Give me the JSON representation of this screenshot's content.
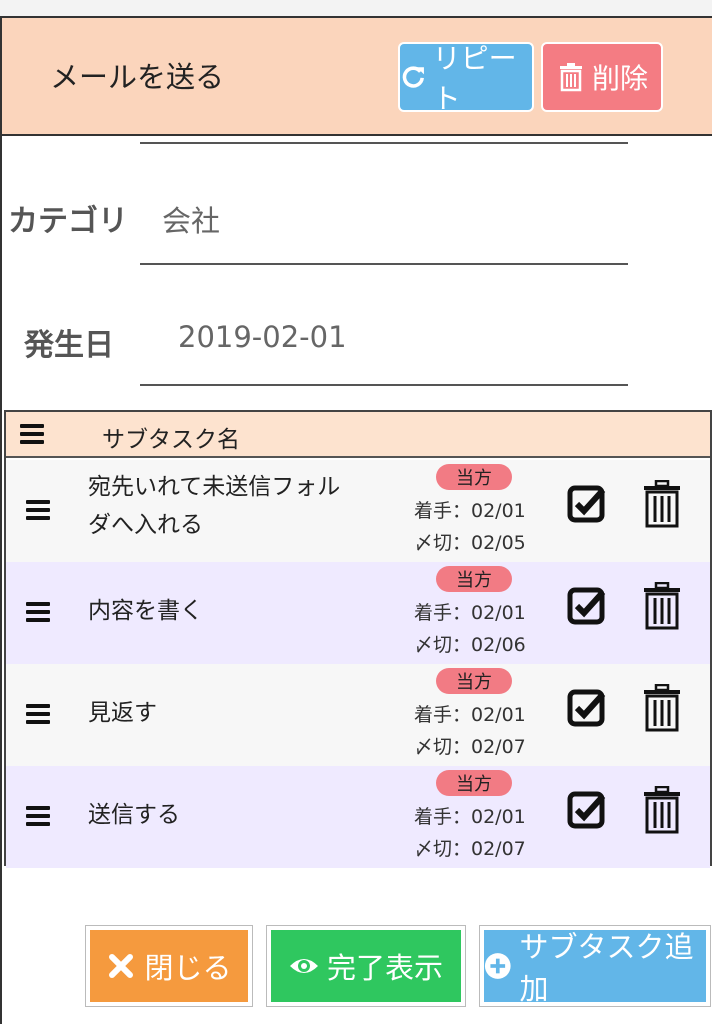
{
  "header": {
    "title": "メールを送る",
    "repeat_label": "リピート",
    "delete_label": "削除"
  },
  "fields": {
    "category_label": "カテゴリ",
    "category_value": "会社",
    "date_label": "発生日",
    "date_value": "2019-02-01"
  },
  "subtasks": {
    "column_header": "サブタスク名",
    "rows": [
      {
        "name_line1": "宛先いれて未送信フォル",
        "name_line2": "ダへ入れる",
        "badge": "当方",
        "start": "着手：02/01",
        "due": "〆切：02/05"
      },
      {
        "name_line1": "内容を書く",
        "name_line2": "",
        "badge": "当方",
        "start": "着手：02/01",
        "due": "〆切：02/06"
      },
      {
        "name_line1": "見返す",
        "name_line2": "",
        "badge": "当方",
        "start": "着手：02/01",
        "due": "〆切：02/07"
      },
      {
        "name_line1": "送信する",
        "name_line2": "",
        "badge": "当方",
        "start": "着手：02/01",
        "due": "〆切：02/07"
      }
    ]
  },
  "footer": {
    "close_label": "閉じる",
    "show_done_label": "完了表示",
    "add_subtask_label": "サブタスク追加"
  },
  "colors": {
    "header_bg": "#fbd5bc",
    "repeat_btn": "#62b6e8",
    "delete_btn": "#f47c83",
    "badge": "#f27b84",
    "close_btn": "#f59a3e",
    "done_btn": "#2fc75f",
    "add_btn": "#62b6e8",
    "row_even": "#efeaff"
  },
  "icons": [
    "refresh-icon",
    "trash-icon",
    "drag-handle-icon",
    "check-square-icon",
    "close-icon",
    "eye-icon",
    "plus-circle-icon"
  ]
}
